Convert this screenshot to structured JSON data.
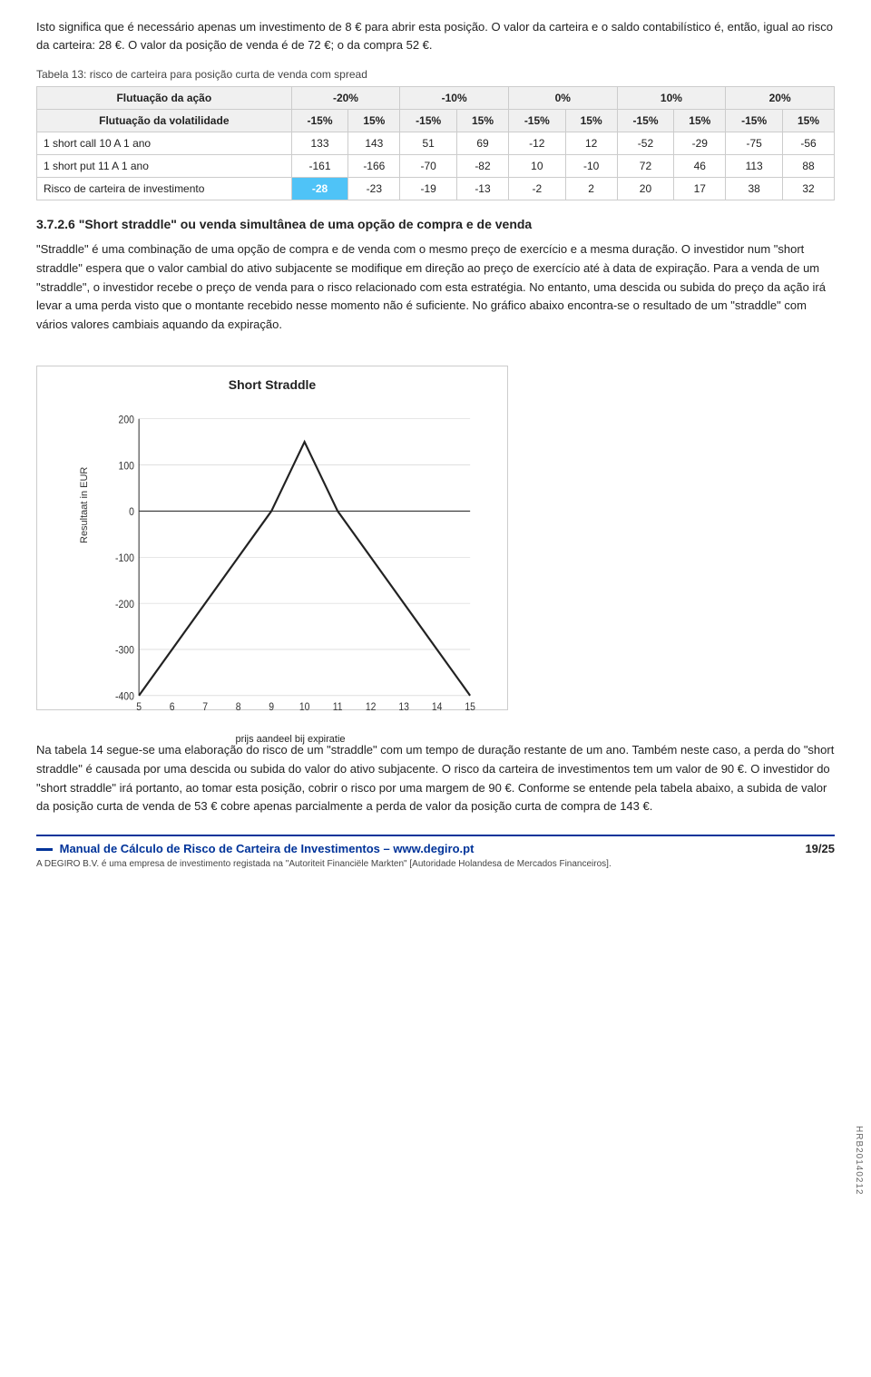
{
  "intro": {
    "p1": "Isto significa que é necessário apenas um investimento de 8 € para abrir esta posição. O valor da carteira e o saldo contabilístico é, então, igual ao risco da carteira: 28 €. O valor da posição de venda é de 72 €; o da compra 52 €.",
    "table_caption": "Tabela 13: risco de carteira para posição curta de venda com spread"
  },
  "table": {
    "headers": [
      "Flutuação da ação",
      "-20%",
      "-10%",
      "0%",
      "10%",
      "20%"
    ],
    "subheader_label": "Flutuação da volatilidade",
    "subheader_cols": [
      "-15%",
      "15%",
      "-15%",
      "15%",
      "-15%",
      "15%",
      "-15%",
      "15%",
      "-15%",
      "15%"
    ],
    "rows": [
      {
        "label": "1 short call 10 A 1 ano",
        "values": [
          "133",
          "143",
          "51",
          "69",
          "-12",
          "12",
          "-52",
          "-29",
          "-75",
          "-56"
        ]
      },
      {
        "label": "1 short put 11 A 1 ano",
        "values": [
          "-161",
          "-166",
          "-70",
          "-82",
          "10",
          "-10",
          "72",
          "46",
          "113",
          "88"
        ]
      },
      {
        "label": "Risco de carteira de investimento",
        "values": [
          "-28",
          "-23",
          "-19",
          "-13",
          "-2",
          "2",
          "20",
          "17",
          "38",
          "32"
        ],
        "highlight_first": true
      }
    ]
  },
  "section": {
    "heading": "3.7.2.6 \"Short straddle\" ou venda simultânea de uma opção de compra e de venda",
    "paragraphs": [
      "\"Straddle\" é uma combinação de uma opção de compra e de venda com o mesmo preço de exercício e a mesma duração. O investidor num \"short straddle\" espera que o valor cambial do ativo subjacente se modifique em direção ao preço de exercício até à data de expiração. Para a venda de um \"straddle\", o investidor recebe o preço de venda para o risco relacionado com esta estratégia. No entanto, uma descida ou subida do preço da ação irá levar a uma perda visto que o montante recebido nesse momento não é suficiente. No gráfico abaixo encontra-se o resultado de um \"straddle\" com vários valores cambiais aquando da expiração."
    ]
  },
  "chart": {
    "title": "Short Straddle",
    "y_label": "Resultaat in EUR",
    "x_label": "prijs aandeel bij expiratie",
    "y_ticks": [
      "200",
      "100",
      "0",
      "-100",
      "-200",
      "-300",
      "-400"
    ],
    "x_ticks": [
      "5",
      "6",
      "7",
      "8",
      "9",
      "10",
      "11",
      "12",
      "13",
      "14",
      "15"
    ],
    "data_points": [
      {
        "x": 5,
        "y": -400
      },
      {
        "x": 6,
        "y": -300
      },
      {
        "x": 7,
        "y": -200
      },
      {
        "x": 8,
        "y": -100
      },
      {
        "x": 9,
        "y": 0
      },
      {
        "x": 10,
        "y": 150
      },
      {
        "x": 11,
        "y": 0
      },
      {
        "x": 12,
        "y": -100
      },
      {
        "x": 13,
        "y": -200
      },
      {
        "x": 14,
        "y": -300
      },
      {
        "x": 15,
        "y": -400
      }
    ]
  },
  "after_text": {
    "paragraphs": [
      "Na tabela 14 segue-se uma elaboração do risco de um \"straddle\" com um tempo de duração restante de um ano. Também neste caso, a perda do \"short straddle\" é causada por uma descida ou subida do valor do ativo subjacente. O risco da carteira de investimentos tem um valor de 90 €. O investidor do \"short straddle\" irá portanto, ao tomar esta posição, cobrir o risco por uma margem de 90 €. Conforme se entende pela tabela abaixo, a subida de valor da posição curta de venda de 53 € cobre apenas parcialmente a perda de valor da posição curta de compra de 143 €."
    ]
  },
  "footer": {
    "brand": "Manual de Cálculo de Risco de Carteira de Investimentos – www.degiro.pt",
    "legal": "A DEGIRO B.V. é uma empresa de investimento registada na \"Autoriteit Financiële Markten\" [Autoridade Holandesa de Mercados Financeiros].",
    "page": "19/25",
    "watermark": "HRB20140212"
  }
}
